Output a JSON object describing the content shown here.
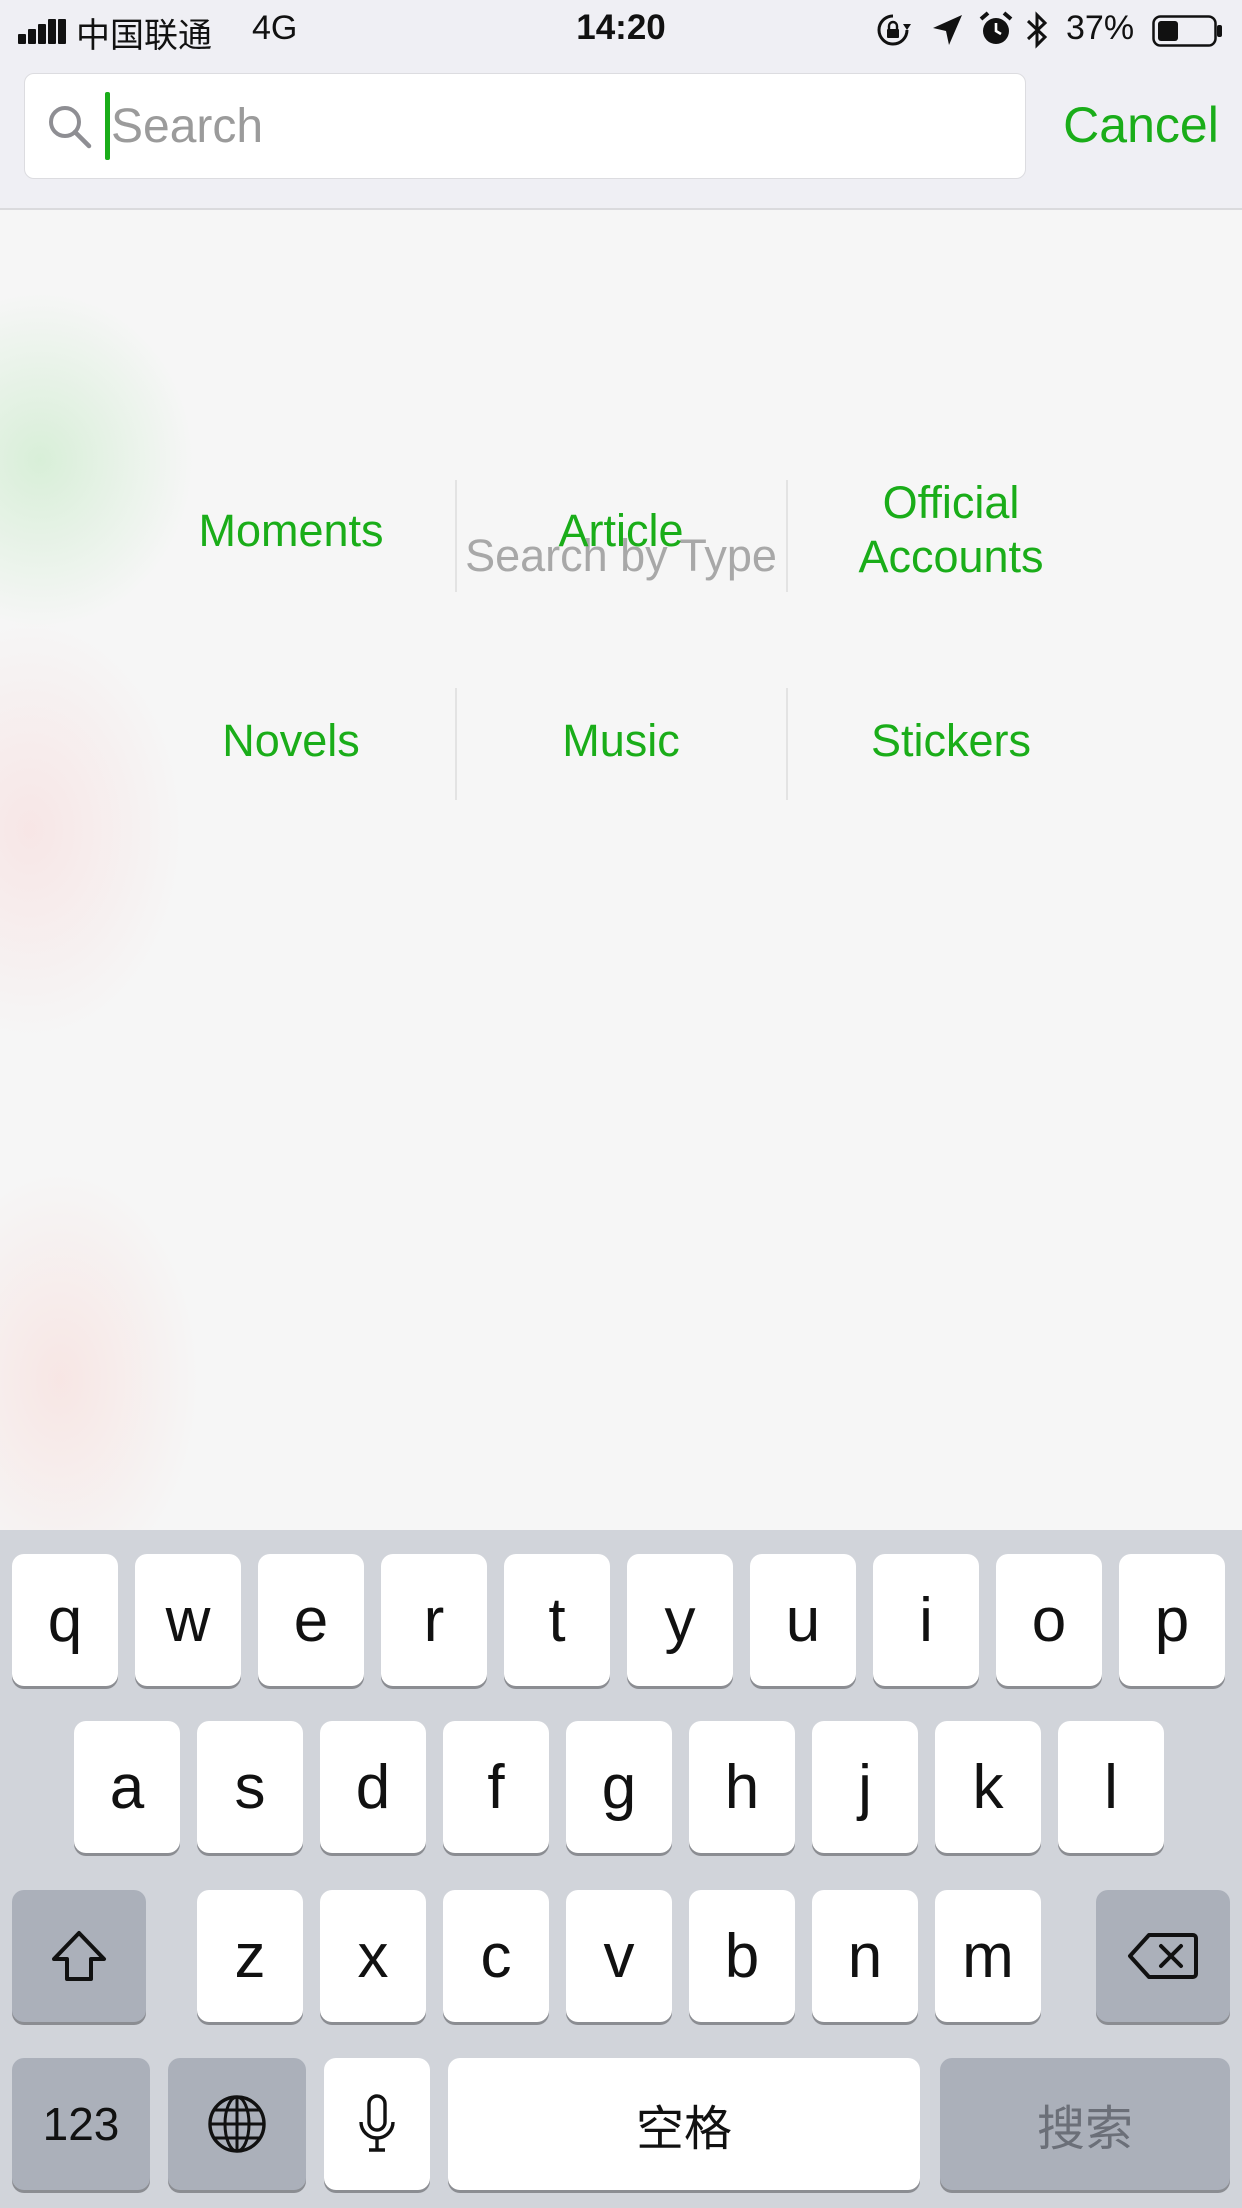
{
  "status_bar": {
    "carrier": "中国联通",
    "network": "4G",
    "time": "14:20",
    "battery_percent": "37%",
    "battery_level": 0.37,
    "icons": [
      "signal-icon",
      "rotation-lock-icon",
      "location-arrow-icon",
      "alarm-icon",
      "bluetooth-icon",
      "battery-icon"
    ]
  },
  "search": {
    "placeholder": "Search",
    "value": "",
    "cancel_label": "Cancel"
  },
  "search_by_type": {
    "title": "Search by Type",
    "rows": [
      [
        {
          "label": "Moments"
        },
        {
          "label": "Article"
        },
        {
          "label_lines": [
            "Official",
            "Accounts"
          ]
        }
      ],
      [
        {
          "label": "Novels"
        },
        {
          "label": "Music"
        },
        {
          "label": "Stickers"
        }
      ]
    ]
  },
  "keyboard": {
    "row1": [
      "q",
      "w",
      "e",
      "r",
      "t",
      "y",
      "u",
      "i",
      "o",
      "p"
    ],
    "row2": [
      "a",
      "s",
      "d",
      "f",
      "g",
      "h",
      "j",
      "k",
      "l"
    ],
    "row3": [
      "z",
      "x",
      "c",
      "v",
      "b",
      "n",
      "m"
    ],
    "numbers_label": "123",
    "space_label": "空格",
    "search_label": "搜索",
    "icons": [
      "shift-icon",
      "delete-icon",
      "globe-icon",
      "microphone-icon"
    ]
  },
  "colors": {
    "accent_green": "#1aad19",
    "header_bg": "#efeff4",
    "keyboard_bg": "#d1d4da",
    "dark_key": "#abb0ba"
  }
}
